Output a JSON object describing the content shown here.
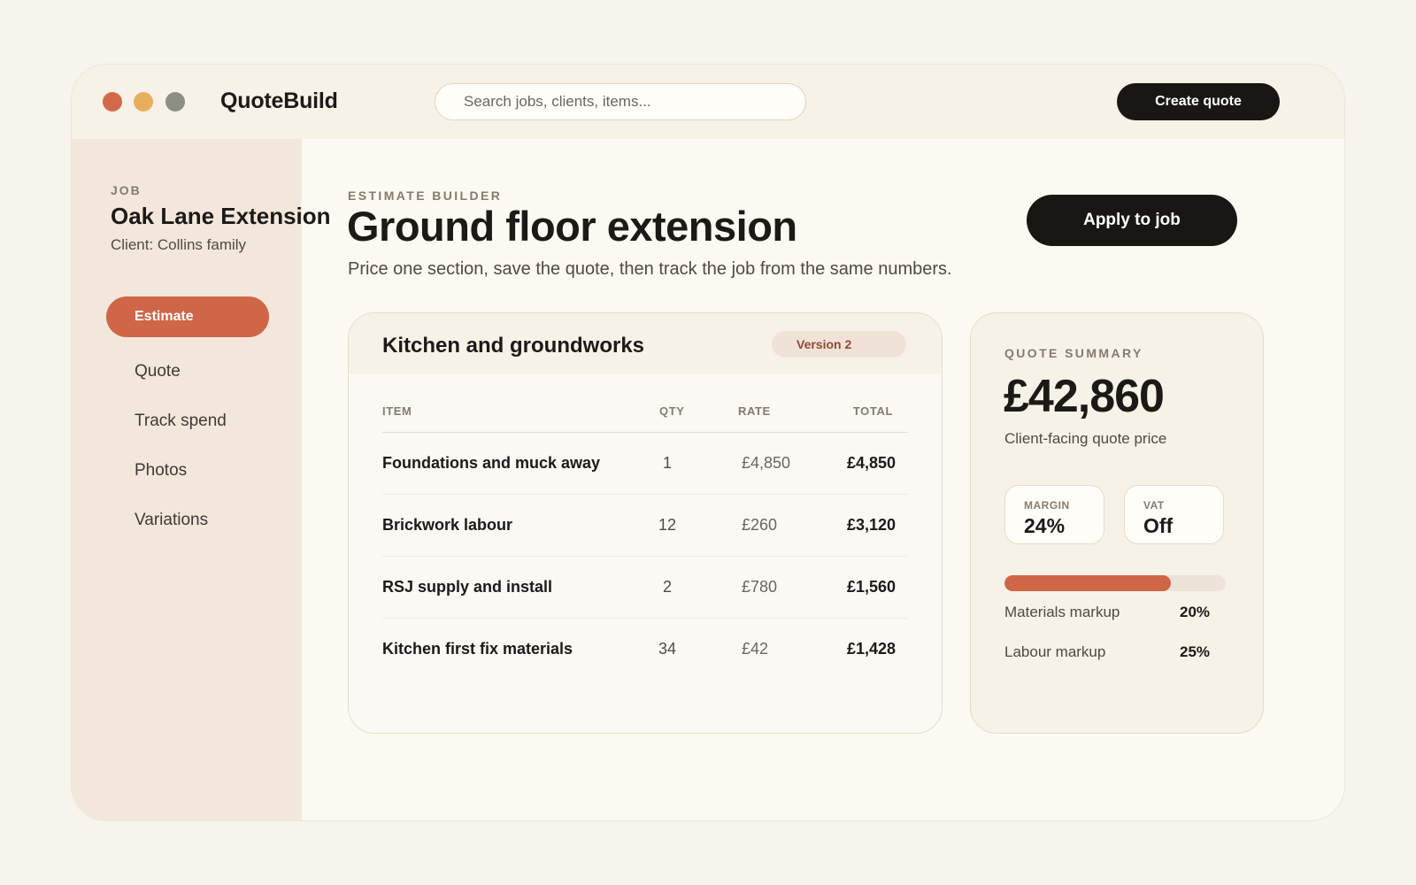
{
  "app": {
    "title": "QuoteBuild"
  },
  "search": {
    "placeholder": "Search jobs, clients, items..."
  },
  "header": {
    "create_label": "Create quote"
  },
  "sidebar": {
    "job_label": "JOB",
    "job_title": "Oak Lane Extension",
    "client": "Client: Collins family",
    "items": [
      {
        "label": "Estimate",
        "active": true
      },
      {
        "label": "Quote"
      },
      {
        "label": "Track spend"
      },
      {
        "label": "Photos"
      },
      {
        "label": "Variations"
      }
    ]
  },
  "main": {
    "eyebrow": "ESTIMATE BUILDER",
    "title": "Ground floor extension",
    "subtitle": "Price one section, save the quote, then track the job from the same numbers.",
    "apply_label": "Apply to job"
  },
  "estimate": {
    "title": "Kitchen and groundworks",
    "version": "Version 2",
    "columns": {
      "item": "ITEM",
      "qty": "QTY",
      "rate": "RATE",
      "total": "TOTAL"
    },
    "rows": [
      {
        "item": "Foundations and muck away",
        "qty": "1",
        "rate": "£4,850",
        "total": "£4,850"
      },
      {
        "item": "Brickwork labour",
        "qty": "12",
        "rate": "£260",
        "total": "£3,120"
      },
      {
        "item": "RSJ supply and install",
        "qty": "2",
        "rate": "£780",
        "total": "£1,560"
      },
      {
        "item": "Kitchen first fix materials",
        "qty": "34",
        "rate": "£42",
        "total": "£1,428"
      }
    ]
  },
  "summary": {
    "eyebrow": "QUOTE SUMMARY",
    "price": "£42,860",
    "caption": "Client-facing quote price",
    "margin_label": "MARGIN",
    "margin_value": "24%",
    "vat_label": "VAT",
    "vat_value": "Off",
    "progress_fraction": 0.75,
    "materials_label": "Materials markup",
    "materials_value": "20%",
    "labour_label": "Labour markup",
    "labour_value": "25%"
  },
  "colors": {
    "accent": "#cf6647",
    "dark": "#191713",
    "sidebar": "#f3e7dc",
    "background": "#f6f4ec"
  }
}
